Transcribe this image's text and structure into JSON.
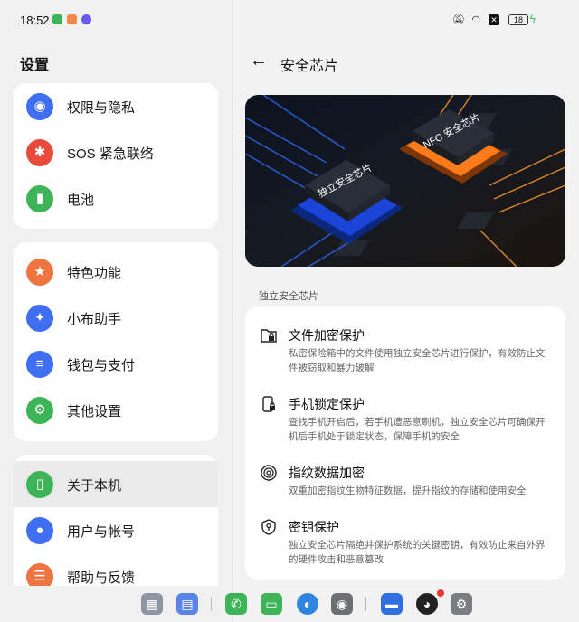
{
  "status": {
    "time": "18:52",
    "battery": "18"
  },
  "left": {
    "title": "设置",
    "groups": [
      {
        "items": [
          {
            "label": "权限与隐私",
            "color": "#3f6ef0",
            "glyph": "◉"
          },
          {
            "label": "SOS 紧急联络",
            "color": "#e84a3c",
            "glyph": "✱"
          },
          {
            "label": "电池",
            "color": "#3cb457",
            "glyph": "▮"
          }
        ]
      },
      {
        "items": [
          {
            "label": "特色功能",
            "color": "#ee7442",
            "glyph": "★"
          },
          {
            "label": "小布助手",
            "color": "#3f6ef0",
            "glyph": "✦"
          },
          {
            "label": "钱包与支付",
            "color": "#3f6ef0",
            "glyph": "≡"
          },
          {
            "label": "其他设置",
            "color": "#3cb457",
            "glyph": "⚙"
          }
        ]
      },
      {
        "items": [
          {
            "label": "关于本机",
            "color": "#3cb457",
            "glyph": "▯"
          },
          {
            "label": "用户与帐号",
            "color": "#3f6ef0",
            "glyph": "●"
          },
          {
            "label": "帮助与反馈",
            "color": "#ee7442",
            "glyph": "☰"
          }
        ]
      }
    ]
  },
  "right": {
    "title": "安全芯片",
    "hero": {
      "chip1": "独立安全芯片",
      "chip2": "NFC 安全芯片"
    },
    "section": "独立安全芯片",
    "features": [
      {
        "name": "文件加密保护",
        "desc": "私密保险箱中的文件使用独立安全芯片进行保护，有效防止文件被窃取和暴力破解",
        "icon": "folder-lock-icon"
      },
      {
        "name": "手机锁定保护",
        "desc": "查找手机开启后，若手机遭恶意刷机，独立安全芯片可确保开机后手机处于锁定状态，保障手机的安全",
        "icon": "phone-lock-icon"
      },
      {
        "name": "指纹数据加密",
        "desc": "双重加密指纹生物特征数据，提升指纹的存储和使用安全",
        "icon": "fingerprint-icon"
      },
      {
        "name": "密钥保护",
        "desc": "独立安全芯片隔绝并保护系统的关键密钥，有效防止来自外界的硬件攻击和恶意篡改",
        "icon": "key-shield-icon"
      }
    ]
  }
}
